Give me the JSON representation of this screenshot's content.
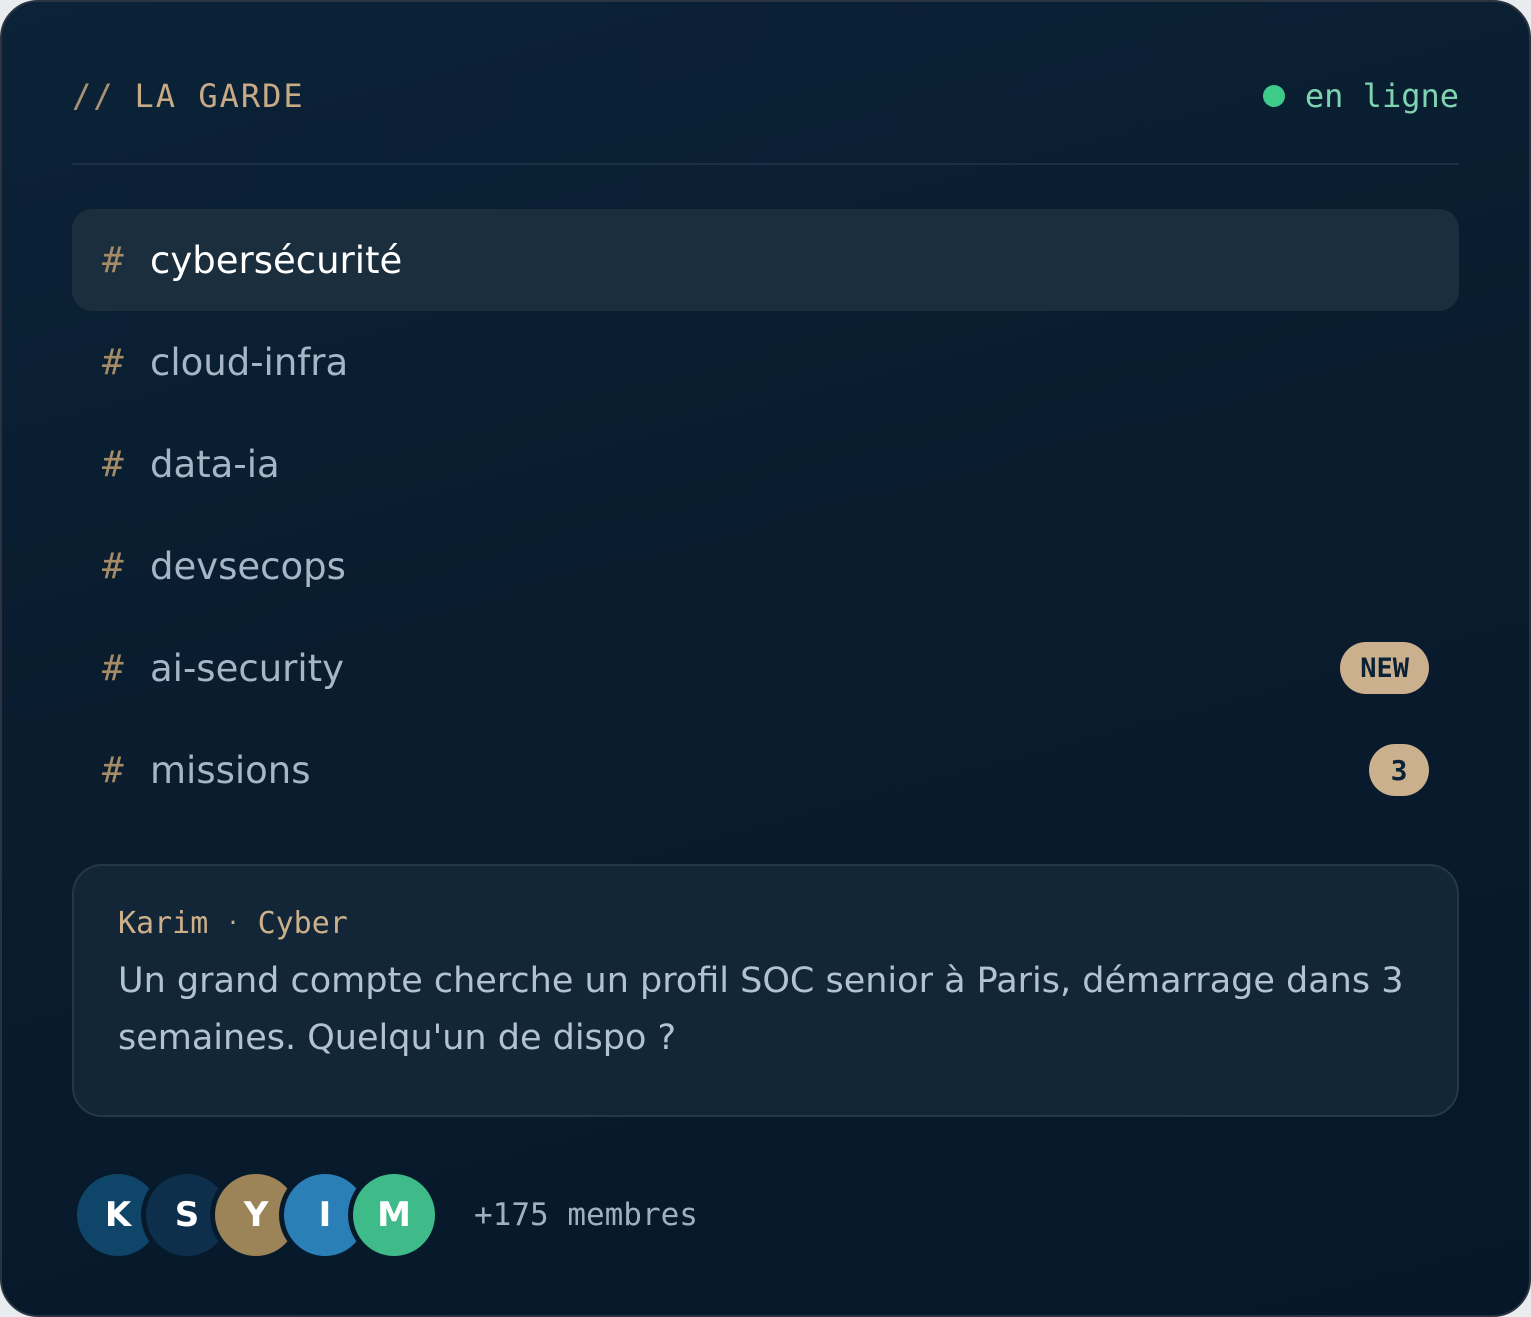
{
  "header": {
    "prefix": "//",
    "title": "LA GARDE",
    "status_label": "en ligne",
    "status_color": "#3ecb8a"
  },
  "channels": [
    {
      "hash": "#",
      "name": "cybersécurité",
      "active": true,
      "badge": ""
    },
    {
      "hash": "#",
      "name": "cloud-infra",
      "active": false,
      "badge": ""
    },
    {
      "hash": "#",
      "name": "data-ia",
      "active": false,
      "badge": ""
    },
    {
      "hash": "#",
      "name": "devsecops",
      "active": false,
      "badge": ""
    },
    {
      "hash": "#",
      "name": "ai-security",
      "active": false,
      "badge": "NEW"
    },
    {
      "hash": "#",
      "name": "missions",
      "active": false,
      "badge": "3"
    }
  ],
  "message": {
    "author": "Karim",
    "separator": "·",
    "team": "Cyber",
    "text": "Un grand compte cherche un profil SOC senior à Paris, démarrage dans 3 semaines. Quelqu'un de dispo ?"
  },
  "members": {
    "avatars": [
      {
        "initial": "K",
        "color": "#0f4569"
      },
      {
        "initial": "S",
        "color": "#0d2f4b"
      },
      {
        "initial": "Y",
        "color": "#9c8358"
      },
      {
        "initial": "I",
        "color": "#2b7fb7"
      },
      {
        "initial": "M",
        "color": "#3fba89"
      }
    ],
    "count_label": "+175 membres"
  },
  "colors": {
    "accent_gold": "#cbb08d",
    "online_green": "#3ecb8a",
    "background": "#0a1c2e"
  }
}
